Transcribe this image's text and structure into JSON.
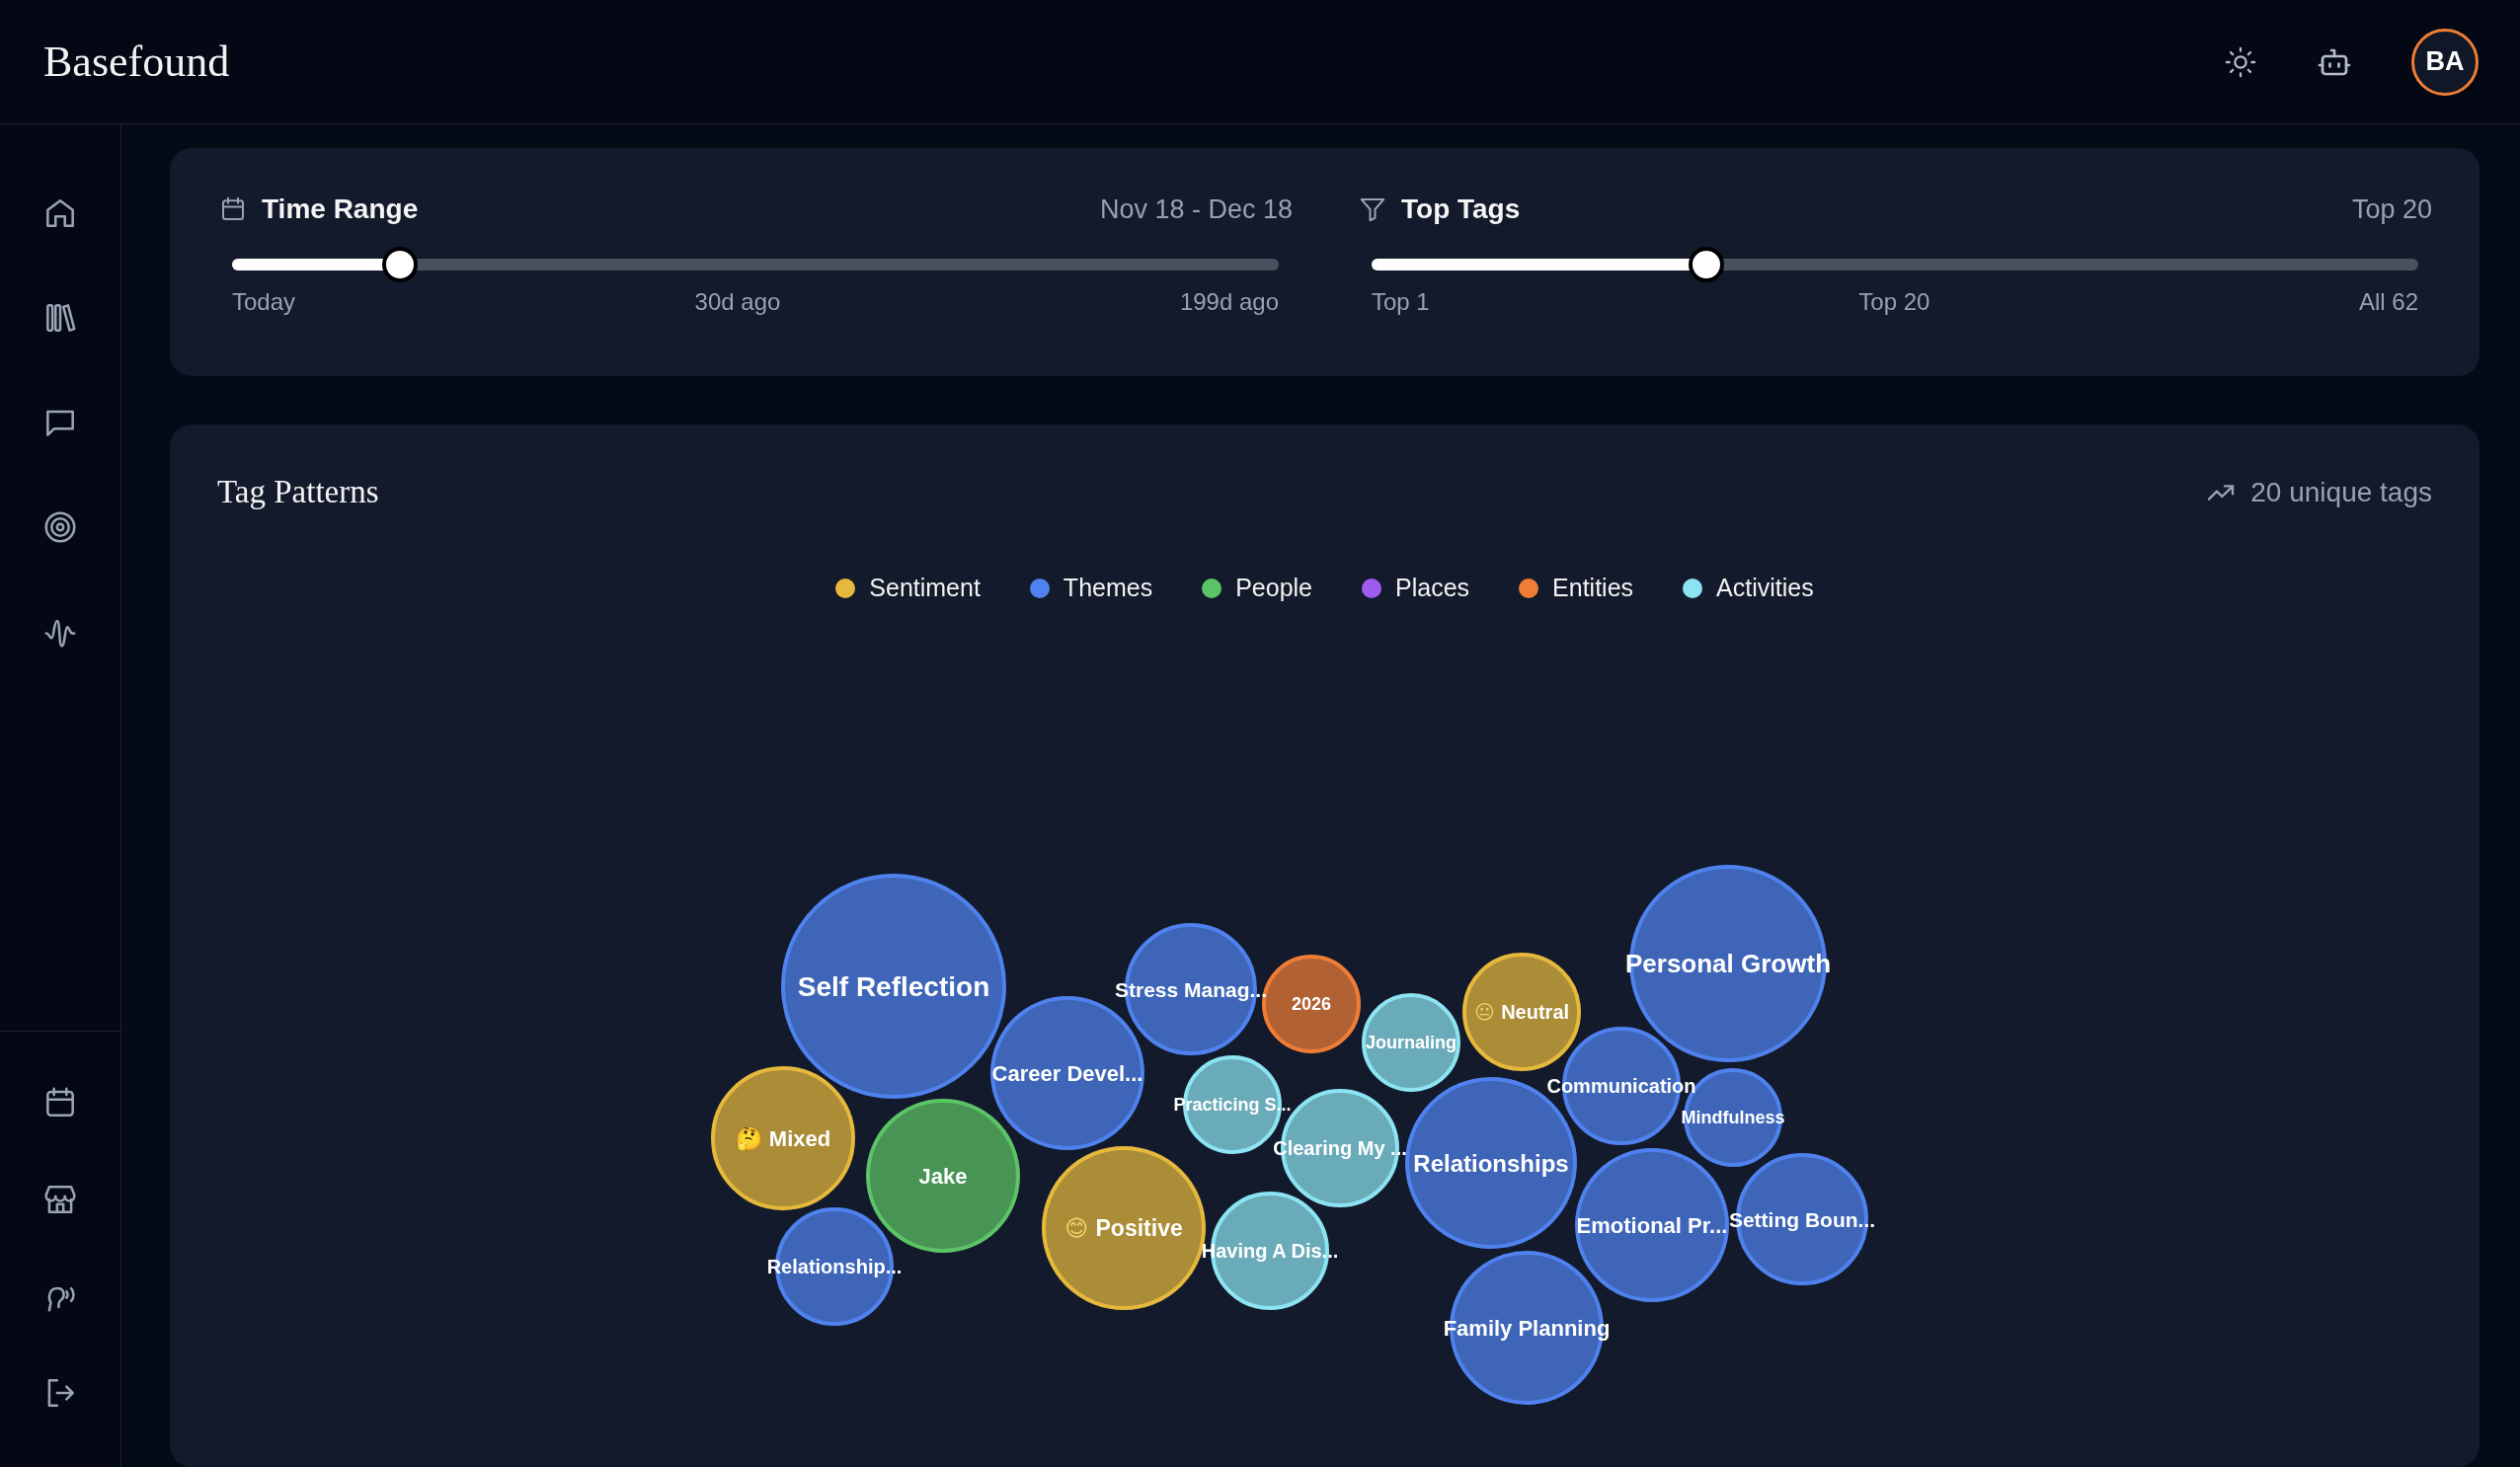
{
  "header": {
    "brand": "Basefound",
    "avatar": "BA"
  },
  "filters": [
    {
      "title": "Time Range",
      "value": "Nov 18 - Dec 18",
      "level": 0.16,
      "ticks": [
        "Today",
        "30d ago",
        "199d ago"
      ]
    },
    {
      "title": "Top Tags",
      "value": "Top 20",
      "level": 0.32,
      "ticks": [
        "Top 1",
        "Top 20",
        "All 62"
      ]
    }
  ],
  "tag_patterns": {
    "title": "Tag Patterns",
    "count": "20 unique tags",
    "legend": [
      {
        "label": "Sentiment",
        "color": "#e6b83c"
      },
      {
        "label": "Themes",
        "color": "#4f82ee"
      },
      {
        "label": "People",
        "color": "#5cc466"
      },
      {
        "label": "Places",
        "color": "#a05cf0"
      },
      {
        "label": "Entities",
        "color": "#ef7d35"
      },
      {
        "label": "Activities",
        "color": "#8ce4f2"
      }
    ],
    "bubbles": [
      {
        "label": "Self Reflection",
        "color": "#4f82ee"
      },
      {
        "label": "Mixed",
        "emoji": "🤔",
        "color": "#e6b83c"
      },
      {
        "label": "Jake",
        "color": "#5cc466"
      },
      {
        "label": "Relationship...",
        "color": "#4f82ee"
      },
      {
        "label": "Career Devel...",
        "color": "#4f82ee"
      },
      {
        "label": "Stress Manag...",
        "color": "#4f82ee"
      },
      {
        "label": "Positive",
        "emoji": "😊",
        "color": "#e6b83c"
      },
      {
        "label": "2026",
        "color": "#ef7d35"
      },
      {
        "label": "Practicing S...",
        "color": "#8ce4f2"
      },
      {
        "label": "Having A Dis...",
        "color": "#8ce4f2"
      },
      {
        "label": "Clearing My ...",
        "color": "#8ce4f2"
      },
      {
        "label": "Journaling",
        "color": "#8ce4f2"
      },
      {
        "label": "Neutral",
        "emoji": "😐",
        "color": "#e6b83c"
      },
      {
        "label": "Relationships",
        "color": "#4f82ee"
      },
      {
        "label": "Personal Growth",
        "color": "#4f82ee"
      },
      {
        "label": "Communication",
        "color": "#4f82ee"
      },
      {
        "label": "Mindfulness",
        "color": "#4f82ee"
      },
      {
        "label": "Emotional Pr...",
        "color": "#4f82ee"
      },
      {
        "label": "Setting Boun...",
        "color": "#4f82ee"
      },
      {
        "label": "Family Planning",
        "color": "#4f82ee"
      }
    ]
  }
}
